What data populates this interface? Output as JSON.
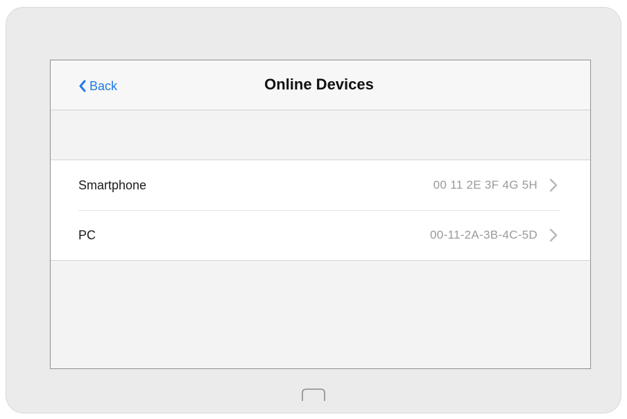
{
  "screen": {
    "back_label": "Back",
    "title": "Online Devices"
  },
  "devices": [
    {
      "name": "Smartphone",
      "mac": "00 11 2E 3F 4G 5H"
    },
    {
      "name": "PC",
      "mac": "00-11-2A-3B-4C-5D"
    }
  ],
  "colors": {
    "accent": "#1f7ae6",
    "secondary_text": "#9a9a9a"
  },
  "icons": {
    "back": "chevron-left-icon",
    "row_disclosure": "chevron-right-icon",
    "home": "home-button-icon"
  }
}
